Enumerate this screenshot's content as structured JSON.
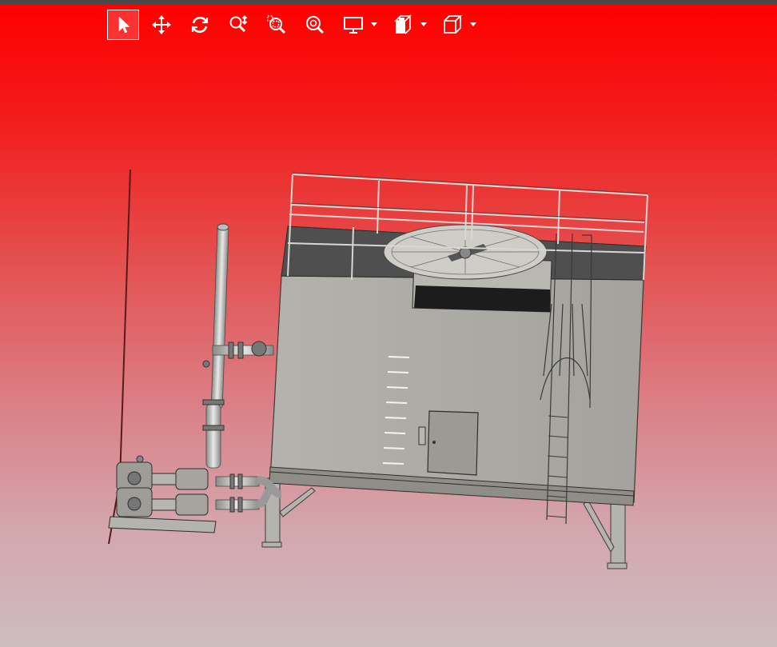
{
  "toolbar": {
    "tools": [
      {
        "name": "select-tool",
        "icon": "arrow-pointer-icon",
        "active": true
      },
      {
        "name": "pan-tool",
        "icon": "move-arrows-icon",
        "active": false
      },
      {
        "name": "rotate-tool",
        "icon": "rotate-icon",
        "active": false
      },
      {
        "name": "zoom-tool",
        "icon": "zoom-vertical-icon",
        "active": false
      },
      {
        "name": "zoom-window-tool",
        "icon": "zoom-window-icon",
        "active": false
      },
      {
        "name": "zoom-fit-tool",
        "icon": "zoom-fit-icon",
        "active": false
      },
      {
        "name": "display-mode-tool",
        "icon": "monitor-icon",
        "has_dropdown": true
      },
      {
        "name": "section-tool",
        "icon": "section-box-icon",
        "has_dropdown": true
      },
      {
        "name": "view-orientation-tool",
        "icon": "cube-view-icon",
        "has_dropdown": true
      }
    ]
  },
  "colors": {
    "viewport_top": "#ff0000",
    "viewport_bottom": "#cdbcc0",
    "model_body": "#a9a7a1",
    "model_dark": "#4e4e4e",
    "toolbar_icon": "#ffffff"
  },
  "model": {
    "description_icon": "cooling-tower-model"
  }
}
